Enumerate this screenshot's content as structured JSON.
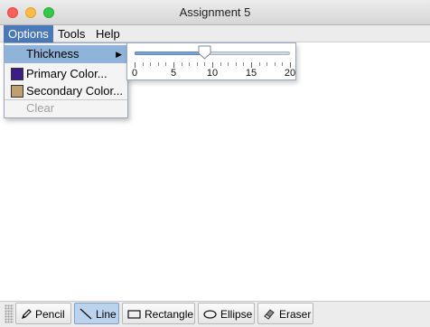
{
  "window": {
    "title": "Assignment 5"
  },
  "menubar": {
    "items": [
      {
        "label": "Options",
        "active": true
      },
      {
        "label": "Tools"
      },
      {
        "label": "Help"
      }
    ]
  },
  "options_menu": {
    "thickness_label": "Thickness",
    "primary_label": "Primary Color...",
    "secondary_label": "Secondary Color...",
    "clear_label": "Clear",
    "primary_color": "#3b1f86",
    "secondary_color": "#bfa071"
  },
  "thickness_slider": {
    "min": 0,
    "max": 20,
    "value": 9,
    "major_tick_spacing": 5,
    "minor_tick_spacing": 1,
    "tick_labels": [
      "0",
      "5",
      "10",
      "15",
      "20"
    ]
  },
  "toolbar": {
    "tools": [
      {
        "label": "Pencil",
        "icon": "pencil-icon",
        "selected": false
      },
      {
        "label": "Line",
        "icon": "line-icon",
        "selected": true
      },
      {
        "label": "Rectangle",
        "icon": "rectangle-icon",
        "selected": false
      },
      {
        "label": "Ellipse",
        "icon": "ellipse-icon",
        "selected": false
      },
      {
        "label": "Eraser",
        "icon": "eraser-icon",
        "selected": false
      }
    ]
  }
}
